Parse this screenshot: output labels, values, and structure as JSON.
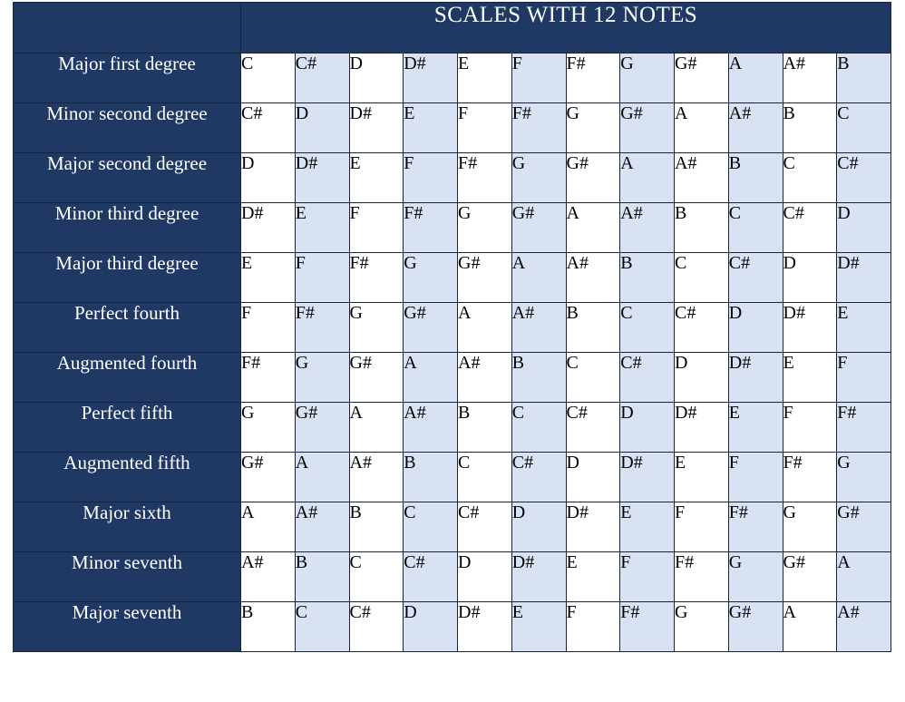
{
  "page": {
    "background_color": "#FFFFFF",
    "accent_navy": "#1F3864",
    "accent_light_blue": "#D9E2F3",
    "border_color": "#17243C",
    "text_on_navy": "#FFFFFF",
    "text_on_cells": "#000000"
  },
  "table": {
    "title": "SCALES WITH 12 NOTES",
    "corner_label": "",
    "row_count": 12,
    "column_count": 12,
    "row_labels": [
      "Major first degree",
      "Minor second degree",
      "Major second degree",
      "Minor third degree",
      "Major third degree",
      "Perfect fourth",
      "Augmented fourth",
      "Perfect fifth",
      "Augmented fifth",
      "Major sixth",
      "Minor seventh",
      "Major seventh"
    ],
    "rows": [
      [
        "C",
        "C#",
        "D",
        "D#",
        "E",
        "F",
        "F#",
        "G",
        "G#",
        "A",
        "A#",
        "B"
      ],
      [
        "C#",
        "D",
        "D#",
        "E",
        "F",
        "F#",
        "G",
        "G#",
        "A",
        "A#",
        "B",
        "C"
      ],
      [
        "D",
        "D#",
        "E",
        "F",
        "F#",
        "G",
        "G#",
        "A",
        "A#",
        "B",
        "C",
        "C#"
      ],
      [
        "D#",
        "E",
        "F",
        "F#",
        "G",
        "G#",
        "A",
        "A#",
        "B",
        "C",
        "C#",
        "D"
      ],
      [
        "E",
        "F",
        "F#",
        "G",
        "G#",
        "A",
        "A#",
        "B",
        "C",
        "C#",
        "D",
        "D#"
      ],
      [
        "F",
        "F#",
        "G",
        "G#",
        "A",
        "A#",
        "B",
        "C",
        "C#",
        "D",
        "D#",
        "E"
      ],
      [
        "F#",
        "G",
        "G#",
        "A",
        "A#",
        "B",
        "C",
        "C#",
        "D",
        "D#",
        "E",
        "F"
      ],
      [
        "G",
        "G#",
        "A",
        "A#",
        "B",
        "C",
        "C#",
        "D",
        "D#",
        "E",
        "F",
        "F#"
      ],
      [
        "G#",
        "A",
        "A#",
        "B",
        "C",
        "C#",
        "D",
        "D#",
        "E",
        "F",
        "F#",
        "G"
      ],
      [
        "A",
        "A#",
        "B",
        "C",
        "C#",
        "D",
        "D#",
        "E",
        "F",
        "F#",
        "G",
        "G#"
      ],
      [
        "A#",
        "B",
        "C",
        "C#",
        "D",
        "D#",
        "E",
        "F",
        "F#",
        "G",
        "G#",
        "A"
      ],
      [
        "B",
        "C",
        "C#",
        "D",
        "D#",
        "E",
        "F",
        "F#",
        "G",
        "G#",
        "A",
        "A#"
      ]
    ]
  }
}
